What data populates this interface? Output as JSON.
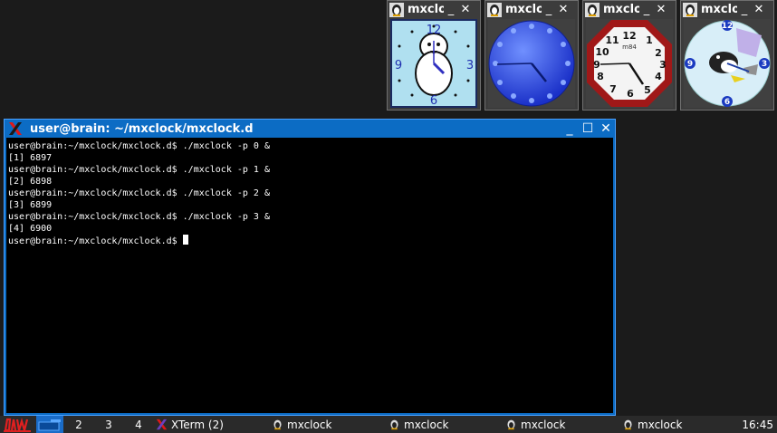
{
  "clock_windows": [
    {
      "title": "mxclock",
      "minimize": "_",
      "close": "✕",
      "numerals": [
        "12",
        "3",
        "6",
        "9"
      ]
    },
    {
      "title": "mxclock",
      "minimize": "_",
      "close": "✕"
    },
    {
      "title": "mxclock",
      "minimize": "_",
      "close": "✕",
      "numerals": [
        "12",
        "1",
        "2",
        "3",
        "4",
        "5",
        "6",
        "7",
        "8",
        "9",
        "10",
        "11"
      ],
      "brand": "m84"
    },
    {
      "title": "mxclock",
      "minimize": "_",
      "close": "✕",
      "numerals": [
        "12",
        "3",
        "6",
        "9"
      ]
    }
  ],
  "xterm": {
    "title": "user@brain: ~/mxclock/mxclock.d",
    "minimize": "_",
    "maximize": "☐",
    "close": "✕",
    "lines": [
      "user@brain:~/mxclock/mxclock.d$ ./mxclock -p 0 &",
      "[1] 6897",
      "user@brain:~/mxclock/mxclock.d$ ./mxclock -p 1 &",
      "[2] 6898",
      "user@brain:~/mxclock/mxclock.d$ ./mxclock -p 2 &",
      "[3] 6899",
      "user@brain:~/mxclock/mxclock.d$ ./mxclock -p 3 &",
      "[4] 6900",
      "user@brain:~/mxclock/mxclock.d$ "
    ]
  },
  "taskbar": {
    "workspaces": [
      "2",
      "3",
      "4"
    ],
    "tasks": [
      {
        "label": "XTerm (2)",
        "icon": "x-icon"
      },
      {
        "label": "mxclock",
        "icon": "mxclock-icon"
      },
      {
        "label": "mxclock",
        "icon": "mxclock-icon"
      },
      {
        "label": "mxclock",
        "icon": "mxclock-icon"
      },
      {
        "label": "mxclock",
        "icon": "mxclock-icon"
      }
    ],
    "clock": "16:45"
  },
  "colors": {
    "xterm_frame": "#0c6cc4",
    "clock1_face": "#b0e0f0",
    "clock2_face": "#3050e0",
    "clock3_rim": "#a01818",
    "taskbar": "#2a2a2a"
  }
}
